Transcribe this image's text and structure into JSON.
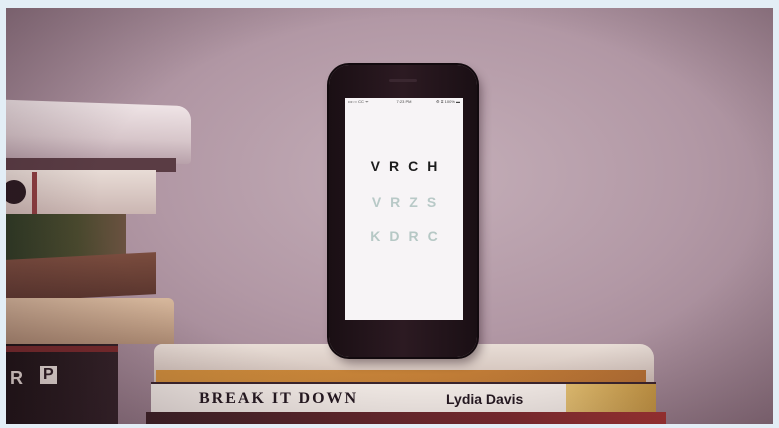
{
  "photo": {
    "caption": ""
  },
  "phone": {
    "status_carrier": "•••○○ CC ᯤ",
    "status_time": "7:23 PM",
    "status_battery": "⚙ ⧖ 100% ▬",
    "eye_chart": {
      "row1": "VRCH",
      "row2": "VRZS",
      "row3": "KDRC"
    }
  },
  "books": {
    "bottom_title": "BREAK IT DOWN",
    "bottom_author": "Lydia Davis",
    "left_spine_letter_r": "R",
    "left_spine_logo": "P"
  },
  "colors": {
    "wall": "#b89ca9",
    "phone_body": "#221419",
    "screen_bg": "#f7f4f6",
    "row1_text": "#1c1c1c",
    "row2_text": "#b8c9c7",
    "row3_text": "#b6c8c5",
    "outer_bg": "#e3eef6"
  }
}
